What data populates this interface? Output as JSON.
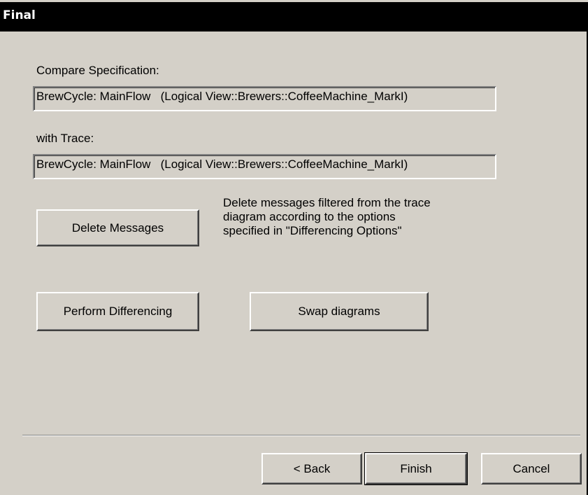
{
  "window": {
    "title": "Final"
  },
  "specification": {
    "label": "Compare Specification:",
    "value": "BrewCycle: MainFlow   (Logical View::Brewers::CoffeeMachine_MarkI)"
  },
  "trace": {
    "label": "with Trace:",
    "value": "BrewCycle: MainFlow   (Logical View::Brewers::CoffeeMachine_MarkI)"
  },
  "actions": {
    "delete_messages_label": "Delete Messages",
    "delete_messages_description": "Delete messages filtered from the trace\ndiagram according to the options\nspecified in \"Differencing Options\"",
    "perform_differencing_label": "Perform Differencing",
    "swap_diagrams_label": "Swap diagrams"
  },
  "footer": {
    "back_label": "< Back",
    "finish_label": "Finish",
    "cancel_label": "Cancel"
  }
}
